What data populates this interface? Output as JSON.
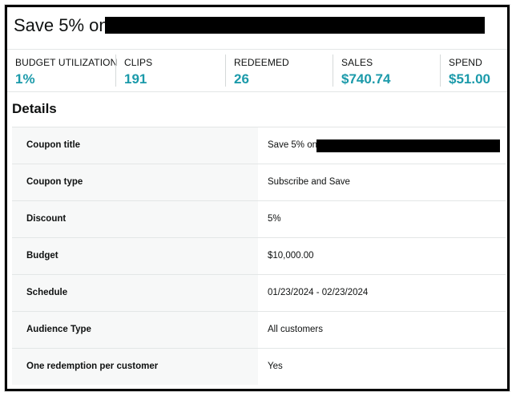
{
  "header": {
    "title": "Save 5% on"
  },
  "metrics": [
    {
      "label": "BUDGET UTILIZATION",
      "value": "1%"
    },
    {
      "label": "CLIPS",
      "value": "191"
    },
    {
      "label": "REDEEMED",
      "value": "26"
    },
    {
      "label": "SALES",
      "value": "$740.74"
    },
    {
      "label": "SPEND",
      "value": "$51.00"
    }
  ],
  "details": {
    "heading": "Details",
    "rows": [
      {
        "label": "Coupon title",
        "value": "Save 5% on"
      },
      {
        "label": "Coupon type",
        "value": "Subscribe and Save"
      },
      {
        "label": "Discount",
        "value": "5%"
      },
      {
        "label": "Budget",
        "value": "$10,000.00"
      },
      {
        "label": "Schedule",
        "value": "01/23/2024 - 02/23/2024"
      },
      {
        "label": "Audience Type",
        "value": "All customers"
      },
      {
        "label": "One redemption per customer",
        "value": "Yes"
      }
    ]
  },
  "colors": {
    "accent": "#1b9aaa",
    "label_bg": "#f7f8f8",
    "border": "#e3e6e6",
    "redaction": "#000000"
  }
}
